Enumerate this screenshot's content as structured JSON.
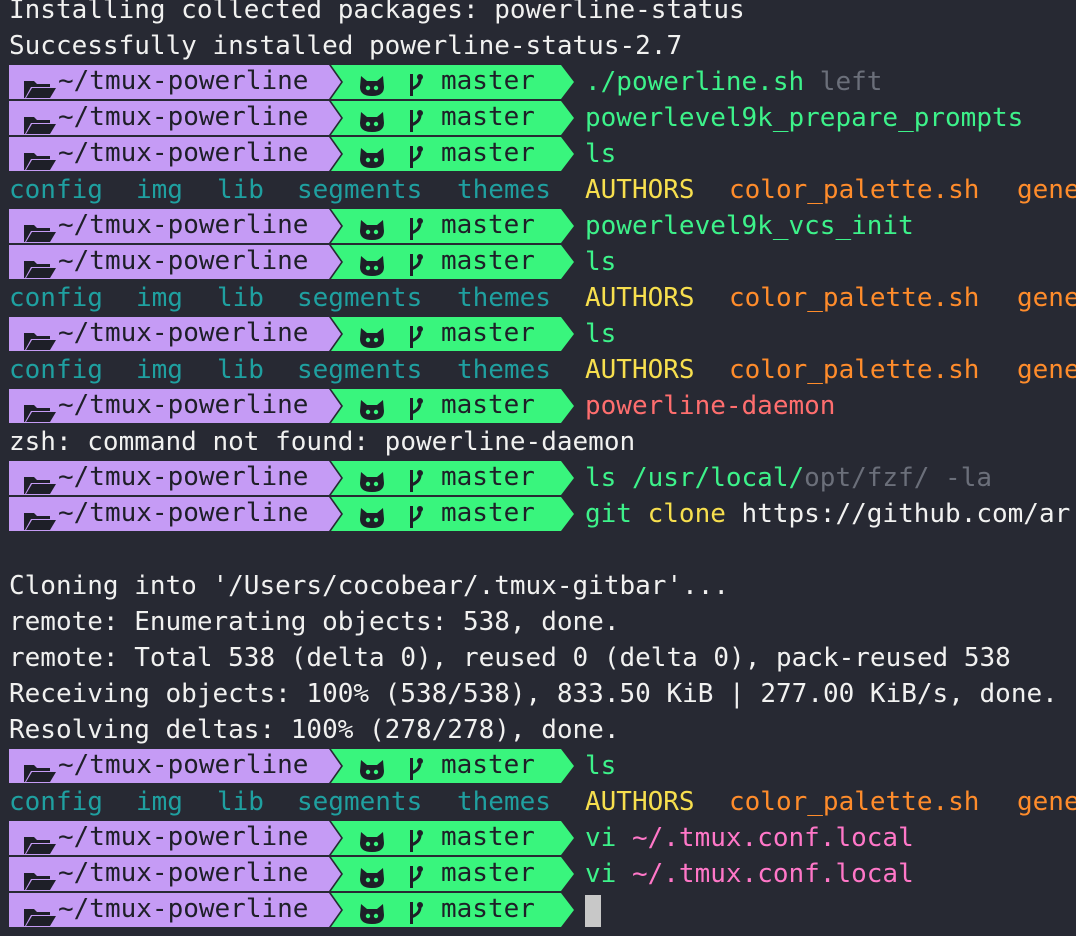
{
  "prompt": {
    "dir": "~/tmux-powerline",
    "branch": "master"
  },
  "colors": {
    "dir_segment": "#c59bf5",
    "git_segment": "#39f57d",
    "background": "#272933",
    "indicator_ok": "#4aa3ff",
    "indicator_err": "#ff4d4d"
  },
  "icons": {
    "folder": "folder-open-icon",
    "git": "github-octocat-icon",
    "branch": "git-branch-icon"
  },
  "output": {
    "install1": "Installing collected packages: powerline-status",
    "install2": "Successfully installed powerline-status-2.7",
    "zsh_error": "zsh: command not found: powerline-daemon",
    "clone1": "Cloning into '/Users/cocobear/.tmux-gitbar'...",
    "clone2": "remote: Enumerating objects: 538, done.",
    "clone3": "remote: Total 538 (delta 0), reused 0 (delta 0), pack-reused 538",
    "clone4": "Receiving objects: 100% (538/538), 833.50 KiB | 277.00 KiB/s, done.",
    "clone5": "Resolving deltas: 100% (278/278), done."
  },
  "ls": {
    "config": "config",
    "img": "img",
    "lib": "lib",
    "segments": "segments",
    "themes": "themes",
    "authors": "AUTHORS",
    "palette": "color_palette.sh",
    "gene": "gene"
  },
  "commands": {
    "c1a": "./powerline.sh",
    "c1b": " left",
    "c2": "powerlevel9k_prepare_prompts",
    "ls": "ls",
    "c4": "powerlevel9k_vcs_init",
    "c7": "powerline-daemon",
    "c8a": "ls /usr/local/",
    "c8b": "opt/fzf/ -la",
    "c9a": "git",
    "c9b": " clone",
    "c9c": " https://github.com/ar",
    "c11a": "vi",
    "c11b": " ~/.tmux.conf.local"
  }
}
